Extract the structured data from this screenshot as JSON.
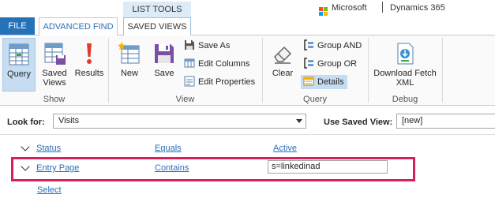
{
  "brand": {
    "company": "Microsoft",
    "product": "Dynamics 365",
    "logo_colors": [
      "#f25022",
      "#7fba00",
      "#00a4ef",
      "#ffb900"
    ]
  },
  "tabs": {
    "file": "FILE",
    "advanced_find": "ADVANCED FIND",
    "list_tools": "LIST TOOLS",
    "saved_views": "SAVED VIEWS"
  },
  "ribbon": {
    "show_group": {
      "label": "Show",
      "query": "Query",
      "saved_views_line1": "Saved",
      "saved_views_line2": "Views",
      "results": "Results"
    },
    "view_group": {
      "label": "View",
      "new": "New",
      "save": "Save",
      "save_as": "Save As",
      "edit_columns": "Edit Columns",
      "edit_properties": "Edit Properties"
    },
    "query_group": {
      "label": "Query",
      "clear": "Clear",
      "group_and": "Group AND",
      "group_or": "Group OR",
      "details": "Details"
    },
    "debug_group": {
      "label": "Debug",
      "download_line1": "Download Fetch",
      "download_line2": "XML"
    }
  },
  "lookfor": {
    "label": "Look for:",
    "value": "Visits",
    "saved_view_label": "Use Saved View:",
    "saved_view_value": "[new]"
  },
  "criteria": {
    "rows": [
      {
        "field": "Status",
        "operator": "Equals",
        "value": "Active"
      },
      {
        "field": "Entry Page",
        "operator": "Contains",
        "value": "s=linkedinad"
      }
    ],
    "select_link": "Select"
  },
  "accent": {
    "highlight": "#d61f5b",
    "link": "#2a6fb8",
    "file_tab": "#2572b8",
    "active_button": "#c5dcf1"
  }
}
